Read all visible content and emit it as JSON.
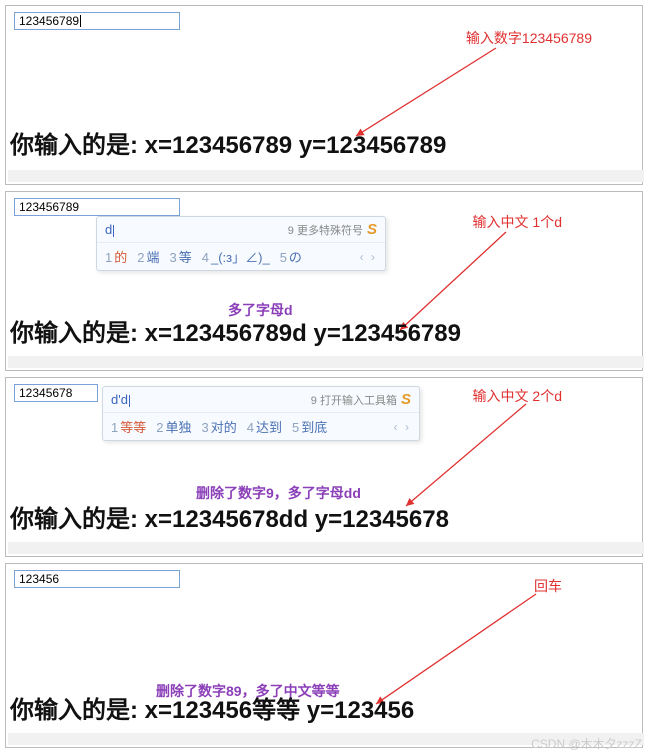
{
  "watermark": "CSDN @木木夕zzzZ",
  "panels": [
    {
      "input_value": "123456789",
      "red_label": "输入数字123456789",
      "output": "你输入的是: x=123456789 y=123456789"
    },
    {
      "input_value": "123456789",
      "red_label": "输入中文 1个d",
      "violet_label": "多了字母d",
      "output": "你输入的是: x=123456789d y=123456789",
      "ime": {
        "typed": "d",
        "hint": "9 更多特殊符号",
        "candidates": [
          {
            "n": "1",
            "t": "的"
          },
          {
            "n": "2",
            "t": "端"
          },
          {
            "n": "3",
            "t": "等"
          },
          {
            "n": "4",
            "t": "_(:з」∠)_"
          },
          {
            "n": "5",
            "t": "の"
          }
        ]
      }
    },
    {
      "input_value": "12345678",
      "red_label": "输入中文 2个d",
      "violet_label": "删除了数字9，多了字母dd",
      "output": "你输入的是: x=12345678dd y=12345678",
      "ime": {
        "typed": "d'd",
        "hint": "9 打开输入工具箱",
        "candidates": [
          {
            "n": "1",
            "t": "等等"
          },
          {
            "n": "2",
            "t": "单独"
          },
          {
            "n": "3",
            "t": "对的"
          },
          {
            "n": "4",
            "t": "达到"
          },
          {
            "n": "5",
            "t": "到底"
          }
        ]
      }
    },
    {
      "input_value": "123456",
      "red_label": "回车",
      "violet_label": "删除了数字89，多了中文等等",
      "output": "你输入的是: x=123456等等 y=123456"
    }
  ]
}
